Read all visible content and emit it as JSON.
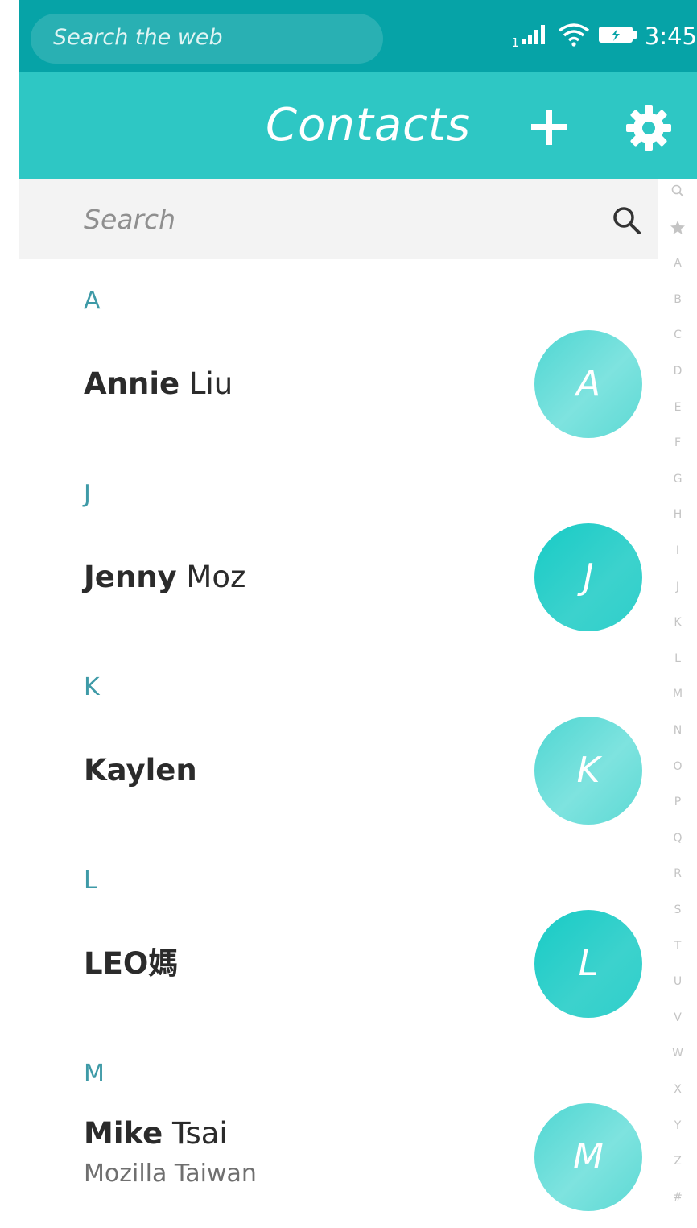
{
  "status_bar": {
    "search_placeholder": "Search the web",
    "sim_number": "1",
    "time": "3:45"
  },
  "header": {
    "title": "Contacts",
    "add_icon": "plus-icon",
    "settings_icon": "gear-icon"
  },
  "search": {
    "placeholder": "Search",
    "icon": "search-icon"
  },
  "index_bar": [
    "search",
    "star",
    "A",
    "B",
    "C",
    "D",
    "E",
    "F",
    "G",
    "H",
    "I",
    "J",
    "K",
    "L",
    "M",
    "N",
    "O",
    "P",
    "Q",
    "R",
    "S",
    "T",
    "U",
    "V",
    "W",
    "X",
    "Y",
    "Z",
    "#"
  ],
  "sections": [
    {
      "letter": "A",
      "contacts": [
        {
          "first": "Annie",
          "last": " Liu",
          "org": "",
          "initial": "A"
        }
      ]
    },
    {
      "letter": "J",
      "contacts": [
        {
          "first": "Jenny",
          "last": " Moz",
          "org": "",
          "initial": "J"
        }
      ]
    },
    {
      "letter": "K",
      "contacts": [
        {
          "first": "Kaylen",
          "last": "",
          "org": "",
          "initial": "K"
        }
      ]
    },
    {
      "letter": "L",
      "contacts": [
        {
          "first": "LEO媽",
          "last": "",
          "org": "",
          "initial": "L"
        }
      ]
    },
    {
      "letter": "M",
      "contacts": [
        {
          "first": "Mike",
          "last": " Tsai",
          "org": "Mozilla Taiwan",
          "initial": "M"
        }
      ]
    }
  ],
  "colors": {
    "status_bar": "#06a3a7",
    "header": "#2ec7c4",
    "section_letter": "#3e9aa7",
    "avatar": "#4fd6d2"
  }
}
